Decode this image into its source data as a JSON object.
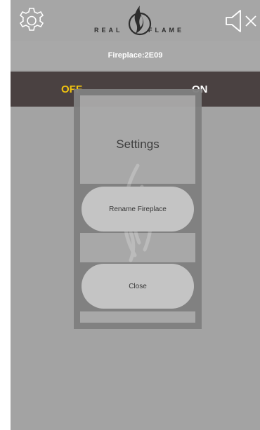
{
  "topbar": {
    "brand_left": "REAL",
    "brand_right": "FLAME",
    "icons": {
      "settings": "gear-icon",
      "sound": "speaker-muted-icon",
      "logo": "flame-logo-icon"
    }
  },
  "subtitle": "Fireplace:2E09",
  "toggle": {
    "off_label": "OFF",
    "on_label": "ON",
    "off_color": "#f1c40f",
    "on_color": "#ffffff"
  },
  "modal": {
    "title": "Settings",
    "rename_label": "Rename Fireplace",
    "close_label": "Close"
  },
  "colors": {
    "background": "#a3a3a3",
    "toggle_bar": "#4a4141",
    "modal_frame": "#808080",
    "button": "#c6c6c6"
  }
}
